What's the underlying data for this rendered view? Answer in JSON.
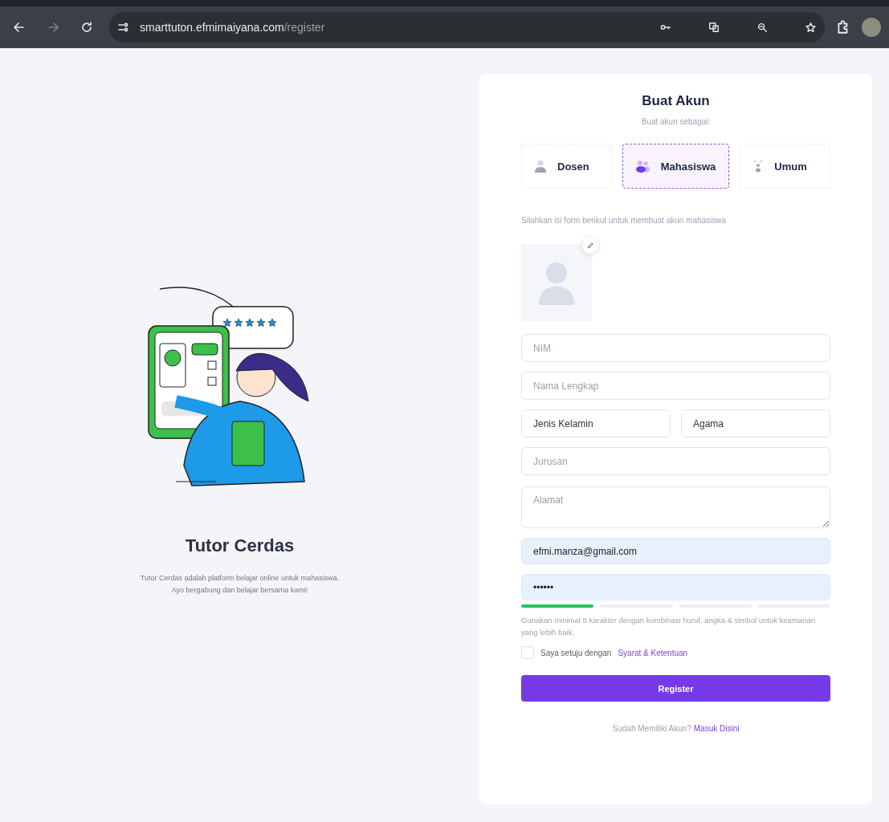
{
  "browser": {
    "url_host": "smarttuton.efmimaiyana.com",
    "url_path": "/register",
    "forward_disabled": true
  },
  "intro": {
    "title": "Tutor Cerdas",
    "description_lines": [
      "Tutor Cerdas adalah platform belajar online untuk mahasiswa.",
      "Ayo bergabung dan belajar bersama kami!"
    ]
  },
  "form": {
    "title": "Buat Akun",
    "subtitle": "Buat akun sebagai:",
    "roles": [
      {
        "label": "Dosen",
        "kind": "single",
        "selected": false
      },
      {
        "label": "Mahasiswa",
        "kind": "group",
        "selected": true
      },
      {
        "label": "Umum",
        "kind": "dots",
        "selected": false
      }
    ],
    "instruction": "Silahkan isi form berikut untuk membuat akun mahasiswa",
    "fields": [
      {
        "kind": "text",
        "placeholder": "NIM",
        "autofilled": false
      },
      {
        "kind": "text",
        "placeholder": "Nama Lengkap",
        "autofilled": false
      },
      {
        "kind": "select-pair",
        "items": [
          {
            "value": "Jenis Kelamin"
          },
          {
            "value": "Agama"
          }
        ]
      },
      {
        "kind": "text",
        "placeholder": "Jurusan",
        "autofilled": false
      },
      {
        "kind": "textarea",
        "placeholder": "Alamat",
        "autofilled": false
      },
      {
        "kind": "text",
        "value": "efmi.manza@gmail.com",
        "autofilled": true
      },
      {
        "kind": "text",
        "value": "••••••",
        "autofilled": true
      }
    ],
    "password_strength": {
      "level": 0.25
    },
    "hint": "Gunakan minimal 8 karakter dengan kombinasi huruf, angka & simbol untuk keamanan yang lebih baik.",
    "agree": {
      "label": "Saya setuju dengan",
      "link": "Syarat & Ketentuan",
      "checked": false
    },
    "submit": "Register",
    "footer": {
      "text": "Sudah Memiliki Akun?",
      "link": "Masuk Disini"
    }
  }
}
